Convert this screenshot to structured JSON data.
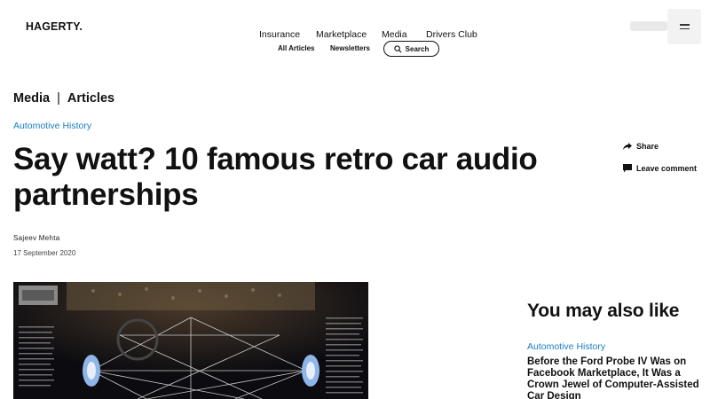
{
  "brand": {
    "logo": "HAGERTY."
  },
  "nav": {
    "main": [
      "Insurance",
      "Marketplace",
      "Media",
      "Drivers Club"
    ],
    "sub": [
      "All Articles",
      "Newsletters"
    ],
    "search_label": "Search"
  },
  "breadcrumb": {
    "section": "Media",
    "separator": "|",
    "page": "Articles"
  },
  "article": {
    "category": "Automotive History",
    "title": "Say watt? 10 famous retro car audio partnerships",
    "author": "Sajeev Mehta",
    "date": "17 September 2020",
    "share_label": "Share",
    "comment_label": "Leave comment"
  },
  "sidebar": {
    "heading": "You may also like",
    "items": [
      {
        "category": "Automotive History",
        "title": "Before the Ford Probe IV Was on Facebook Marketplace, It Was a Crown Jewel of Computer-Assisted Car Design"
      }
    ]
  },
  "colors": {
    "accent": "#1a7fc1",
    "text": "#111111"
  },
  "icons": {
    "search": "search-icon",
    "share": "share-arrow-icon",
    "comment": "comment-bubble-icon",
    "menu": "hamburger-menu-icon"
  }
}
